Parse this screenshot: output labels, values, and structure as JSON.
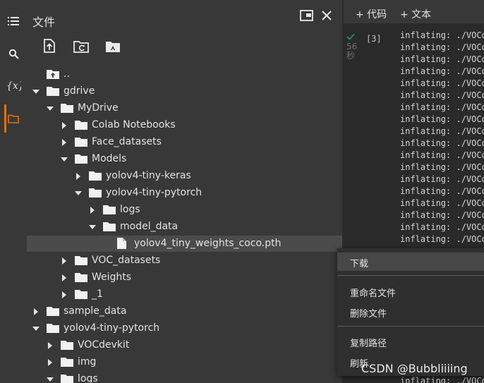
{
  "panel": {
    "title": "文件",
    "tree": [
      {
        "label": "..",
        "depth": 0,
        "kind": "parent",
        "arrow": "none"
      },
      {
        "label": "gdrive",
        "depth": 0,
        "kind": "folder",
        "arrow": "down"
      },
      {
        "label": "MyDrive",
        "depth": 1,
        "kind": "folder",
        "arrow": "down"
      },
      {
        "label": "Colab Notebooks",
        "depth": 2,
        "kind": "folder",
        "arrow": "right"
      },
      {
        "label": "Face_datasets",
        "depth": 2,
        "kind": "folder",
        "arrow": "right"
      },
      {
        "label": "Models",
        "depth": 2,
        "kind": "folder",
        "arrow": "down"
      },
      {
        "label": "yolov4-tiny-keras",
        "depth": 3,
        "kind": "folder",
        "arrow": "right"
      },
      {
        "label": "yolov4-tiny-pytorch",
        "depth": 3,
        "kind": "folder",
        "arrow": "down"
      },
      {
        "label": "logs",
        "depth": 4,
        "kind": "folder",
        "arrow": "right"
      },
      {
        "label": "model_data",
        "depth": 4,
        "kind": "folder",
        "arrow": "down"
      },
      {
        "label": "yolov4_tiny_weights_coco.pth",
        "depth": 5,
        "kind": "file",
        "arrow": "none",
        "selected": true
      },
      {
        "label": "VOC_datasets",
        "depth": 2,
        "kind": "folder",
        "arrow": "right"
      },
      {
        "label": "Weights",
        "depth": 2,
        "kind": "folder",
        "arrow": "right"
      },
      {
        "label": "_1",
        "depth": 2,
        "kind": "folder",
        "arrow": "right"
      },
      {
        "label": "sample_data",
        "depth": 0,
        "kind": "folder",
        "arrow": "right"
      },
      {
        "label": "yolov4-tiny-pytorch",
        "depth": 0,
        "kind": "folder",
        "arrow": "down"
      },
      {
        "label": "VOCdevkit",
        "depth": 1,
        "kind": "folder",
        "arrow": "right"
      },
      {
        "label": "img",
        "depth": 1,
        "kind": "folder",
        "arrow": "right"
      },
      {
        "label": "logs",
        "depth": 1,
        "kind": "folder",
        "arrow": "down"
      }
    ]
  },
  "notebook": {
    "add_code": "+ 代码",
    "add_text": "+ 文本",
    "exec_count": "[3]",
    "exec_time_value": "56",
    "exec_time_unit": "秒",
    "output_lines": [
      "inflating: ./VOCd",
      "inflating: ./VOCd",
      "inflating: ./VOCd",
      "inflating: ./VOCd",
      "inflating: ./VOCd",
      "inflating: ./VOCd",
      "inflating: ./VOCd",
      "inflating: ./VOCd",
      "inflating: ./VOCd",
      "inflating: ./VOCd",
      "inflating: ./VOCd",
      "inflating: ./VOCd",
      "inflating: ./VOCd",
      "inflating: ./VOCd",
      "inflating: ./VOCd",
      "inflating: ./VOCd",
      "inflating: ./VOCd",
      "inflating: ./VOCd"
    ],
    "last_line": "inflating: ./VOCd"
  },
  "context_menu": {
    "download": "下载",
    "rename": "重命名文件",
    "delete": "删除文件",
    "copy_path": "复制路径",
    "refresh": "刷新"
  },
  "watermark": "CSDN @Bubbliiiing",
  "colors": {
    "accent": "#e8710a",
    "success": "#1e8e3e",
    "background": "#383838"
  }
}
